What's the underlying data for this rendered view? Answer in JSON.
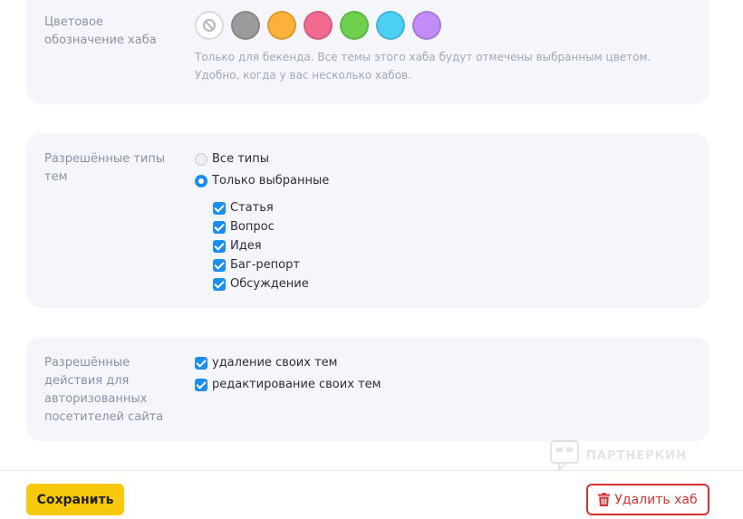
{
  "hub_color": {
    "label": "Цветовое обозначение хаба",
    "hint": "Только для бекенда. Все темы этого хаба будут отмечены выбранным цветом. Удобно, когда у вас несколько хабов.",
    "swatches": [
      {
        "name": "none",
        "color": "#ffffff",
        "selected": true
      },
      {
        "name": "gray",
        "color": "#9b9b9b"
      },
      {
        "name": "orange",
        "color": "#fbb13b"
      },
      {
        "name": "pink",
        "color": "#f36a91"
      },
      {
        "name": "green",
        "color": "#6fd04f"
      },
      {
        "name": "cyan",
        "color": "#4cd0f6"
      },
      {
        "name": "purple",
        "color": "#c18cf5"
      }
    ]
  },
  "allowed_types": {
    "label": "Разрешённые типы тем",
    "mode_options": [
      {
        "label": "Все типы",
        "selected": false
      },
      {
        "label": "Только выбранные",
        "selected": true
      }
    ],
    "types": [
      {
        "label": "Статья",
        "checked": true
      },
      {
        "label": "Вопрос",
        "checked": true
      },
      {
        "label": "Идея",
        "checked": true
      },
      {
        "label": "Баг-репорт",
        "checked": true
      },
      {
        "label": "Обсуждение",
        "checked": true
      }
    ]
  },
  "allowed_actions": {
    "label": "Разрешённые действия для авторизованных посетителей сайта",
    "options": [
      {
        "label": "удаление своих тем",
        "checked": true
      },
      {
        "label": "редактирование своих тем",
        "checked": true
      }
    ]
  },
  "footer": {
    "save_label": "Сохранить",
    "delete_label": "Удалить хаб"
  },
  "watermark": {
    "text": "ПАРТНЕРКИН"
  },
  "colors": {
    "accent": "#1a8ff0",
    "save_button": "#f8c90a",
    "delete_button": "#d93131",
    "card_background": "#f5f6fc"
  }
}
